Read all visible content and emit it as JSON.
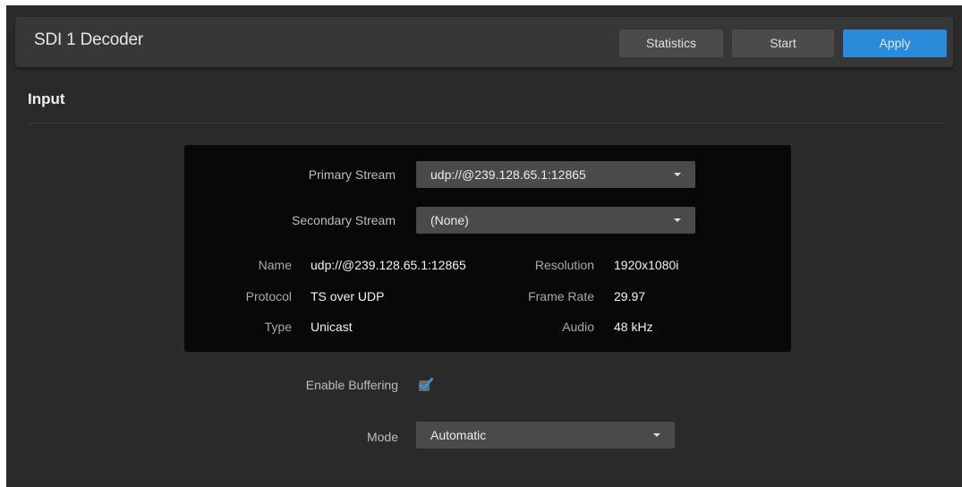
{
  "header": {
    "title": "SDI 1 Decoder",
    "statistics_label": "Statistics",
    "start_label": "Start",
    "apply_label": "Apply"
  },
  "section": {
    "title": "Input"
  },
  "streams": {
    "primary_label": "Primary Stream",
    "primary_value": "udp://@239.128.65.1:12865",
    "secondary_label": "Secondary Stream",
    "secondary_value": "(None)"
  },
  "info": {
    "name_label": "Name",
    "name_value": "udp://@239.128.65.1:12865",
    "protocol_label": "Protocol",
    "protocol_value": "TS over UDP",
    "type_label": "Type",
    "type_value": "Unicast",
    "resolution_label": "Resolution",
    "resolution_value": "1920x1080i",
    "framerate_label": "Frame Rate",
    "framerate_value": "29.97",
    "audio_label": "Audio",
    "audio_value": "48 kHz"
  },
  "buffering": {
    "label": "Enable Buffering",
    "checked": true
  },
  "mode": {
    "label": "Mode",
    "value": "Automatic"
  },
  "icons": {
    "dropdown": "chevron-down-icon",
    "check": "checkmark-icon"
  },
  "colors": {
    "background": "#2a2a2a",
    "header": "#373737",
    "panel": "#080808",
    "control": "#4a4a4a",
    "accent": "#2b8bd8",
    "check": "#3d8fd6"
  }
}
